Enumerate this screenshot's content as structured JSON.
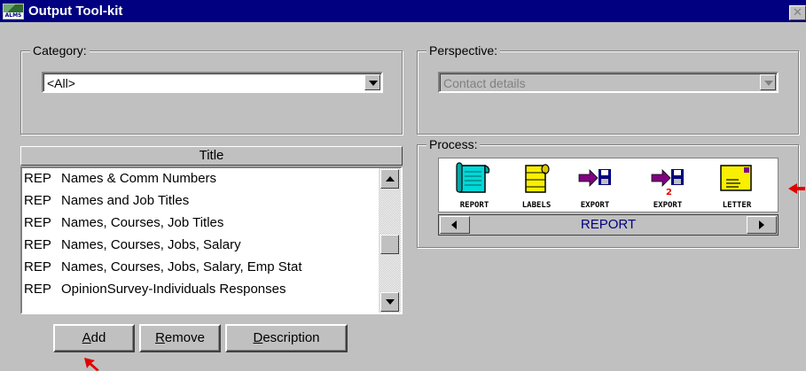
{
  "window": {
    "title": "Output Tool-kit",
    "app_icon_text": "ALMS"
  },
  "category": {
    "label": "Category:",
    "value": "<All>"
  },
  "perspective": {
    "label": "Perspective:",
    "value": "Contact details"
  },
  "titles": {
    "header": "Title",
    "items": [
      {
        "prefix": "REP",
        "text": "Names & Comm Numbers"
      },
      {
        "prefix": "REP",
        "text": "Names and Job Titles"
      },
      {
        "prefix": "REP",
        "text": "Names, Courses, Job Titles"
      },
      {
        "prefix": "REP",
        "text": "Names, Courses, Jobs, Salary"
      },
      {
        "prefix": "REP",
        "text": "Names, Courses, Jobs, Salary, Emp Stat"
      },
      {
        "prefix": "REP",
        "text": "OpinionSurvey-Individuals Responses"
      }
    ]
  },
  "buttons": {
    "add": {
      "accel": "A",
      "rest": "dd"
    },
    "remove": {
      "accel": "R",
      "rest": "emove"
    },
    "description": {
      "accel": "D",
      "rest": "escription"
    }
  },
  "process": {
    "label": "Process:",
    "items": [
      {
        "label": "REPORT",
        "icon": "report-icon"
      },
      {
        "label": "LABELS",
        "icon": "labels-icon"
      },
      {
        "label": "EXPORT",
        "icon": "export-icon"
      },
      {
        "label": "EXPORT",
        "icon": "export-2-icon",
        "badge": "2"
      },
      {
        "label": "LETTER",
        "icon": "letter-icon"
      }
    ],
    "selected": "REPORT"
  },
  "colors": {
    "titlebar": "#000080",
    "face": "#c0c0c0",
    "accent_red": "#e00000"
  }
}
